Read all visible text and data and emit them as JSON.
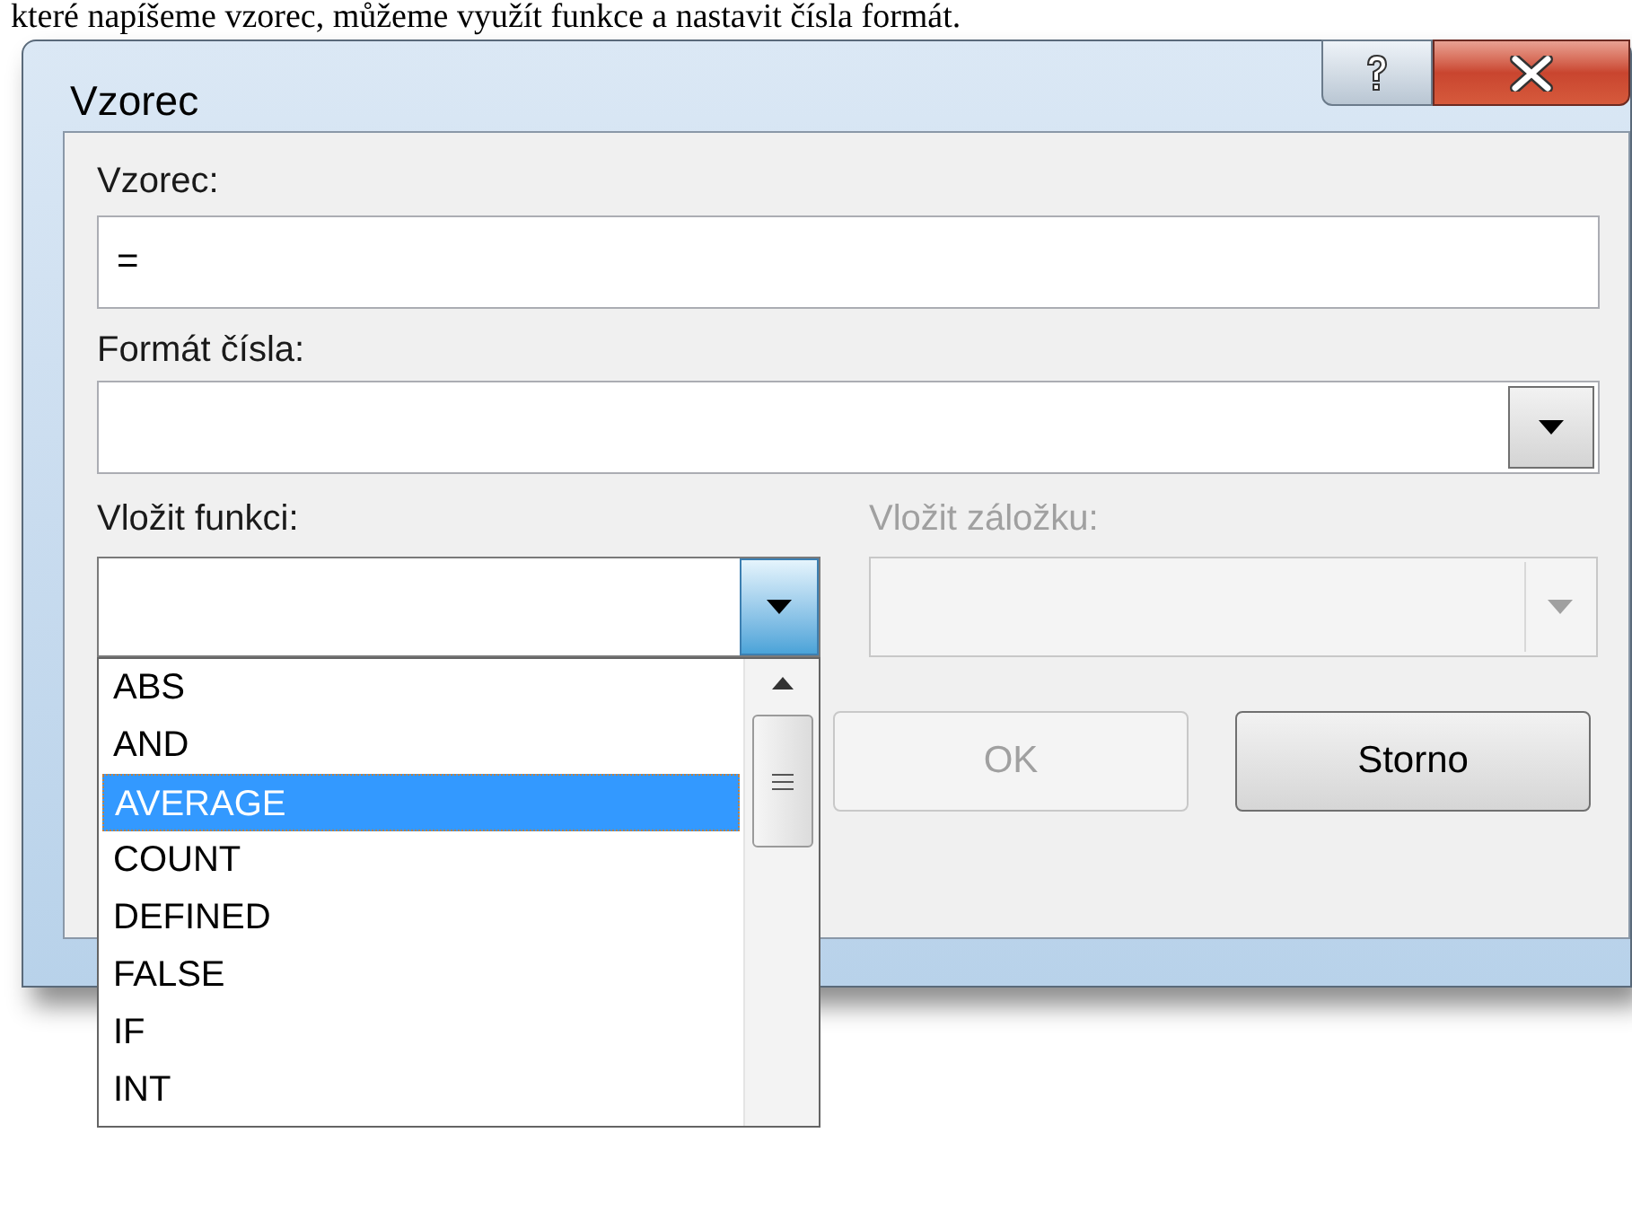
{
  "intro_text": "které napíšeme vzorec, můžeme využít funkce a nastavit čísla formát.",
  "window": {
    "title": "Vzorec"
  },
  "formula": {
    "label": "Vzorec:",
    "value": "="
  },
  "number_format": {
    "label": "Formát čísla:"
  },
  "insert_function": {
    "label": "Vložit funkci:",
    "expanded": true,
    "items": [
      {
        "label": "ABS",
        "selected": false
      },
      {
        "label": "AND",
        "selected": false
      },
      {
        "label": "AVERAGE",
        "selected": true
      },
      {
        "label": "COUNT",
        "selected": false
      },
      {
        "label": "DEFINED",
        "selected": false
      },
      {
        "label": "FALSE",
        "selected": false
      },
      {
        "label": "IF",
        "selected": false
      },
      {
        "label": "INT",
        "selected": false
      }
    ]
  },
  "insert_bookmark": {
    "label": "Vložit záložku:",
    "disabled": true
  },
  "buttons": [
    {
      "label": "OK",
      "disabled": true
    },
    {
      "label": "Storno",
      "disabled": false
    }
  ]
}
